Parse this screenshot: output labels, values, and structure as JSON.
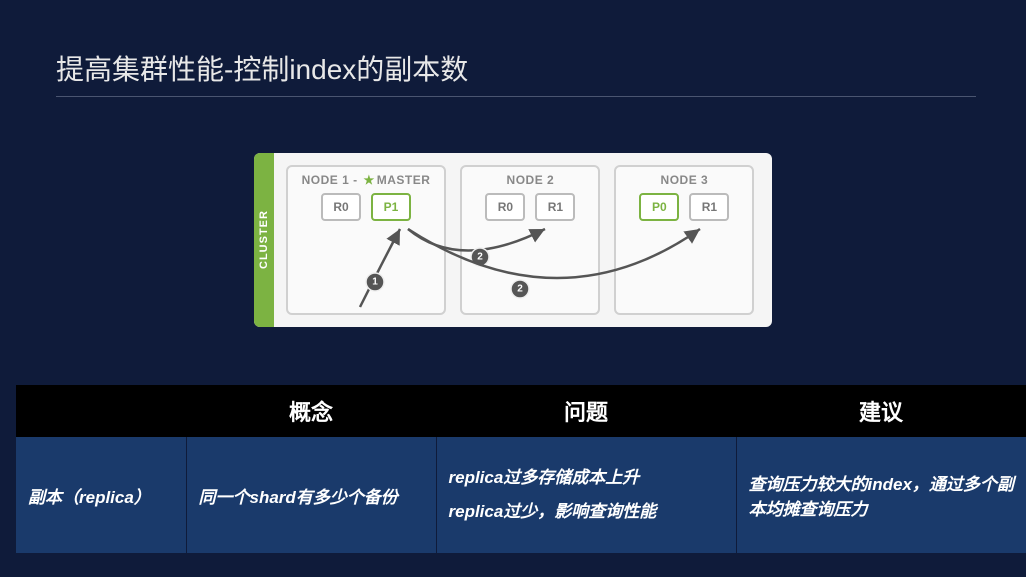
{
  "slide": {
    "title": "提高集群性能-控制index的副本数"
  },
  "cluster": {
    "label": "CLUSTER",
    "nodes": [
      {
        "name_prefix": "NODE 1 - ",
        "master": true,
        "name_suffix": "MASTER",
        "shards": [
          {
            "label": "R0",
            "primary": false
          },
          {
            "label": "P1",
            "primary": true
          }
        ]
      },
      {
        "name_prefix": "NODE 2",
        "master": false,
        "name_suffix": "",
        "shards": [
          {
            "label": "R0",
            "primary": false
          },
          {
            "label": "R1",
            "primary": false
          }
        ]
      },
      {
        "name_prefix": "NODE 3",
        "master": false,
        "name_suffix": "",
        "shards": [
          {
            "label": "P0",
            "primary": true
          },
          {
            "label": "R1",
            "primary": false
          }
        ]
      }
    ],
    "path_labels": [
      "1",
      "2",
      "2"
    ]
  },
  "table": {
    "headers": [
      "",
      "概念",
      "问题",
      "建议"
    ],
    "row": {
      "term": "副本（replica）",
      "concept": "同一个shard有多少个备份",
      "problem_line1": "replica过多存储成本上升",
      "problem_line2": "replica过少，影响查询性能",
      "suggestion": "查询压力较大的index，通过多个副本均摊查询压力"
    }
  }
}
